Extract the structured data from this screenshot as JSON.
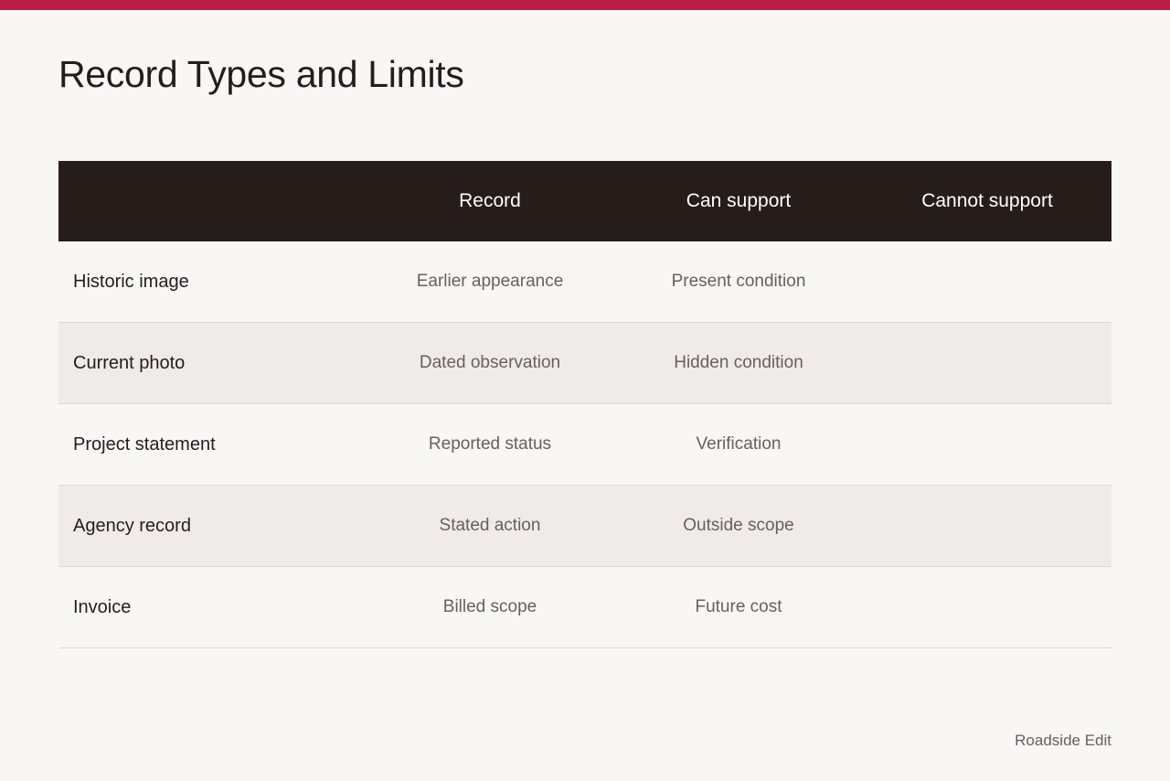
{
  "page": {
    "title": "Record Types and Limits",
    "footer": "Roadside Edit"
  },
  "colors": {
    "background": "#f8f7f5",
    "accent": "#bb1f48",
    "header_bg": "#261d1a",
    "header_text": "#ffffff",
    "title_text": "#261d1a",
    "row_label_text": "#261d1a",
    "cell_text": "#6a5f5a",
    "stripe_bg": "#efebe8",
    "footer_text": "#6a5f5a"
  },
  "table": {
    "headers": [
      "",
      "Record",
      "Can support",
      "Cannot support"
    ],
    "rows": [
      {
        "label": "Historic image",
        "record": "Earlier appearance",
        "can_support": "Present condition",
        "cannot_support": ""
      },
      {
        "label": "Current photo",
        "record": "Dated observation",
        "can_support": "Hidden condition",
        "cannot_support": ""
      },
      {
        "label": "Project statement",
        "record": "Reported status",
        "can_support": "Verification",
        "cannot_support": ""
      },
      {
        "label": "Agency record",
        "record": "Stated action",
        "can_support": "Outside scope",
        "cannot_support": ""
      },
      {
        "label": "Invoice",
        "record": "Billed scope",
        "can_support": "Future cost",
        "cannot_support": ""
      }
    ]
  }
}
